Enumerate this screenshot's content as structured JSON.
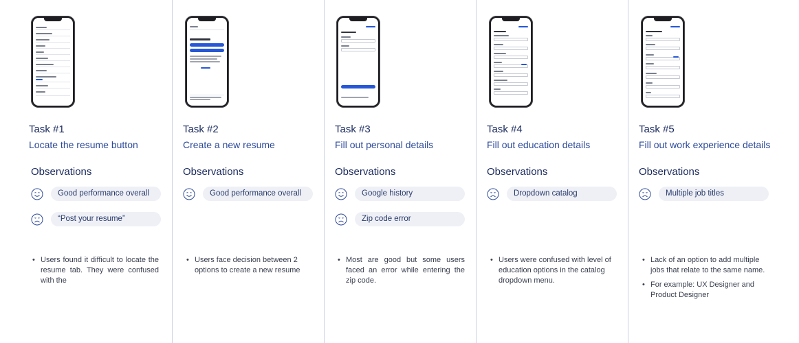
{
  "observations_heading": "Observations",
  "tasks": [
    {
      "number": "Task #1",
      "title": "Locate the resume button",
      "observations": [
        {
          "face": "smile",
          "text": "Good performance overall"
        },
        {
          "face": "frown",
          "text": "“Post your resume”"
        }
      ],
      "notes": [
        "Users found it difficult to locate the resume tab. They were confused with the"
      ]
    },
    {
      "number": "Task #2",
      "title": "Create a new resume",
      "observations": [
        {
          "face": "smile",
          "text": "Good performance overall"
        }
      ],
      "notes": [
        "Users face decision between 2 options to create a new resume"
      ]
    },
    {
      "number": "Task #3",
      "title": "Fill out personal details",
      "observations": [
        {
          "face": "smile",
          "text": "Google history"
        },
        {
          "face": "frown",
          "text": "Zip code error"
        }
      ],
      "notes": [
        "Most are good but some users faced an error while entering the zip code."
      ]
    },
    {
      "number": "Task #4",
      "title": "Fill out education details",
      "observations": [
        {
          "face": "frown",
          "text": "Dropdown catalog"
        }
      ],
      "notes": [
        "Users were confused with level of education options in the catalog dropdown menu."
      ]
    },
    {
      "number": "Task #5",
      "title": "Fill out work experience details",
      "observations": [
        {
          "face": "frown",
          "text": "Multiple job titles"
        }
      ],
      "notes": [
        "Lack of an option to add multiple jobs that relate to the same name.",
        "For example: UX Designer and Product Designer"
      ]
    }
  ],
  "icons": {
    "smile": "smiley-face-icon",
    "frown": "frowning-face-icon"
  },
  "colors": {
    "heading": "#1a2a5e",
    "accent": "#2557d6",
    "pill": "#eef0f6",
    "divider": "#c9d1e6"
  }
}
